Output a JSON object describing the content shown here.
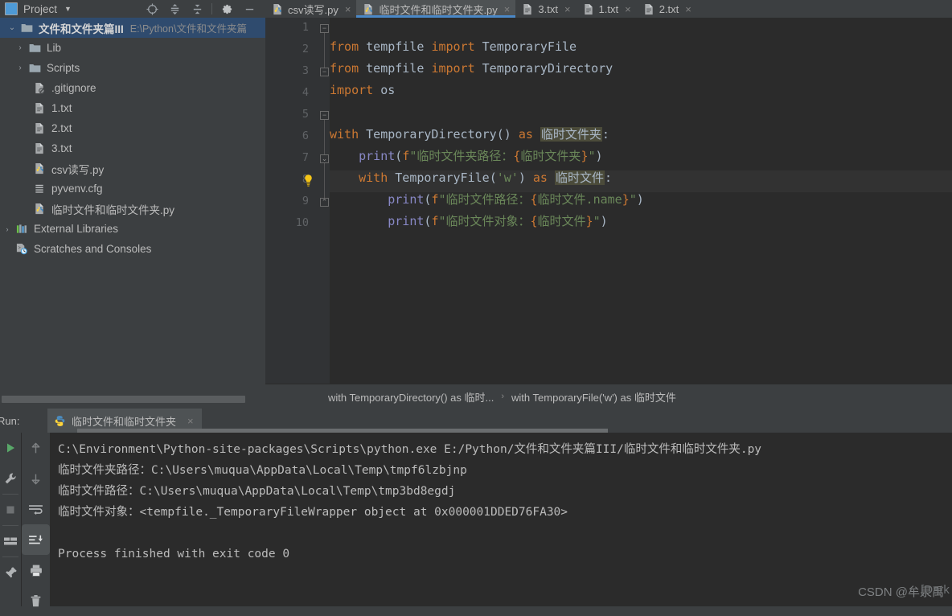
{
  "project_panel": {
    "title": "Project",
    "caret_icon": "chevron-down-icon",
    "tools": [
      {
        "name": "locate-icon",
        "glyph": "target"
      },
      {
        "name": "expand-all-icon",
        "glyph": "expand"
      },
      {
        "name": "collapse-all-icon",
        "glyph": "collapse"
      },
      {
        "name": "settings-gear-icon",
        "glyph": "gear"
      },
      {
        "name": "hide-panel-icon",
        "glyph": "minus"
      }
    ],
    "tree": [
      {
        "label": "文件和文件夹篇III",
        "secondary": "E:\\Python\\文件和文件夹篇",
        "icon": "folder-icon",
        "arrow": "expanded",
        "indent": 0,
        "selected": true,
        "bold": true
      },
      {
        "label": "Lib",
        "secondary": "",
        "icon": "folder-icon",
        "arrow": "collapsed",
        "indent": 1,
        "selected": false,
        "bold": false
      },
      {
        "label": "Scripts",
        "secondary": "",
        "icon": "folder-icon",
        "arrow": "collapsed",
        "indent": 1,
        "selected": false,
        "bold": false
      },
      {
        "label": ".gitignore",
        "secondary": "",
        "icon": "gitignore-file-icon",
        "arrow": "none",
        "indent": 2,
        "selected": false,
        "bold": false
      },
      {
        "label": "1.txt",
        "secondary": "",
        "icon": "text-file-icon",
        "arrow": "none",
        "indent": 2,
        "selected": false,
        "bold": false
      },
      {
        "label": "2.txt",
        "secondary": "",
        "icon": "text-file-icon",
        "arrow": "none",
        "indent": 2,
        "selected": false,
        "bold": false
      },
      {
        "label": "3.txt",
        "secondary": "",
        "icon": "text-file-icon",
        "arrow": "none",
        "indent": 2,
        "selected": false,
        "bold": false
      },
      {
        "label": "csv读写.py",
        "secondary": "",
        "icon": "python-file-icon",
        "arrow": "none",
        "indent": 2,
        "selected": false,
        "bold": false
      },
      {
        "label": "pyvenv.cfg",
        "secondary": "",
        "icon": "config-file-icon",
        "arrow": "none",
        "indent": 2,
        "selected": false,
        "bold": false
      },
      {
        "label": "临时文件和临时文件夹.py",
        "secondary": "",
        "icon": "python-file-icon",
        "arrow": "none",
        "indent": 2,
        "selected": false,
        "bold": false
      },
      {
        "label": "External Libraries",
        "secondary": "",
        "icon": "external-libraries-icon",
        "arrow": "collapsed",
        "indent": 0,
        "selected": false,
        "bold": false
      },
      {
        "label": "Scratches and Consoles",
        "secondary": "",
        "icon": "scratches-icon",
        "arrow": "none",
        "indent": 0,
        "selected": false,
        "bold": false
      }
    ]
  },
  "editor": {
    "tabs": [
      {
        "label": "csv读写.py",
        "icon": "python-file-icon",
        "active": false,
        "close": "×"
      },
      {
        "label": "临时文件和临时文件夹.py",
        "icon": "python-file-icon",
        "active": true,
        "close": "×"
      },
      {
        "label": "3.txt",
        "icon": "text-file-icon",
        "active": false,
        "close": "×"
      },
      {
        "label": "1.txt",
        "icon": "text-file-icon",
        "active": false,
        "close": "×"
      },
      {
        "label": "2.txt",
        "icon": "text-file-icon",
        "active": false,
        "close": "×"
      }
    ],
    "line_numbers": [
      "1",
      "2",
      "3",
      "4",
      "5",
      "6",
      "7",
      "8",
      "9",
      "10"
    ],
    "code_lines": [
      {
        "n": 1,
        "text": "from tempfile import TemporaryFile"
      },
      {
        "n": 2,
        "text": "from tempfile import TemporaryDirectory"
      },
      {
        "n": 3,
        "text": "import os"
      },
      {
        "n": 4,
        "text": ""
      },
      {
        "n": 5,
        "text": "with TemporaryDirectory() as 临时文件夹:"
      },
      {
        "n": 6,
        "text": "    print(f\"临时文件夹路径：{临时文件夹}\")"
      },
      {
        "n": 7,
        "text": "    with TemporaryFile('w') as 临时文件:"
      },
      {
        "n": 8,
        "text": "        print(f\"临时文件路径：{临时文件.name}\")"
      },
      {
        "n": 9,
        "text": "        print(f\"临时文件对象：{临时文件}\")"
      },
      {
        "n": 10,
        "text": ""
      }
    ],
    "highlighted_line": 8,
    "intention_bulb_icon": "lightbulb-icon",
    "breadcrumb": [
      "with TemporaryDirectory() as 临时...",
      "with TemporaryFile('w') as 临时文件"
    ],
    "breadcrumb_separator": "›"
  },
  "run_panel": {
    "label": "Run:",
    "tab_label": "临时文件和临时文件夹",
    "tab_icon": "python-file-icon",
    "tab_close": "×",
    "left_rail": [
      {
        "name": "rerun-button",
        "icon": "play-icon"
      },
      {
        "name": "edit-configurations-button",
        "icon": "wrench-icon"
      },
      {
        "name": "stop-button",
        "icon": "stop-icon"
      },
      {
        "name": "restore-layout-button",
        "icon": "layout-icon"
      },
      {
        "name": "pin-tab-button",
        "icon": "pin-icon"
      }
    ],
    "console_rail": [
      {
        "name": "up-the-stack-button",
        "icon": "arrow-up-icon",
        "active": false
      },
      {
        "name": "down-the-stack-button",
        "icon": "arrow-down-icon",
        "active": false
      },
      {
        "name": "soft-wrap-button",
        "icon": "soft-wrap-icon",
        "active": false
      },
      {
        "name": "scroll-to-end-button",
        "icon": "scroll-to-end-icon",
        "active": true
      },
      {
        "name": "print-button",
        "icon": "printer-icon",
        "active": false
      },
      {
        "name": "clear-all-button",
        "icon": "trash-icon",
        "active": false
      }
    ],
    "console_lines": [
      "C:\\Environment\\Python-site-packages\\Scripts\\python.exe E:/Python/文件和文件夹篇III/临时文件和临时文件夹.py",
      "临时文件夹路径：C:\\Users\\muqua\\AppData\\Local\\Temp\\tmpf6lzbjnp",
      "临时文件路径：C:\\Users\\muqua\\AppData\\Local\\Temp\\tmp3bd8egdj",
      "临时文件对象：<tempfile._TemporaryFileWrapper object at 0x000001DDED76FA30>",
      "",
      "Process finished with exit code 0"
    ]
  },
  "watermark": {
    "text": "CSDN @牟泉禹",
    "overlay": "[Dark Cat]"
  },
  "colors": {
    "panel_bg": "#3c3f41",
    "editor_bg": "#2b2b2b",
    "gutter_bg": "#313335",
    "selection_bg": "#2f4b6e",
    "tab_active_bg": "#4e5254",
    "tab_underline": "#4a88c7",
    "keyword": "#cc7832",
    "string": "#6a8759",
    "text": "#a9b7c6",
    "line_number": "#606366"
  }
}
